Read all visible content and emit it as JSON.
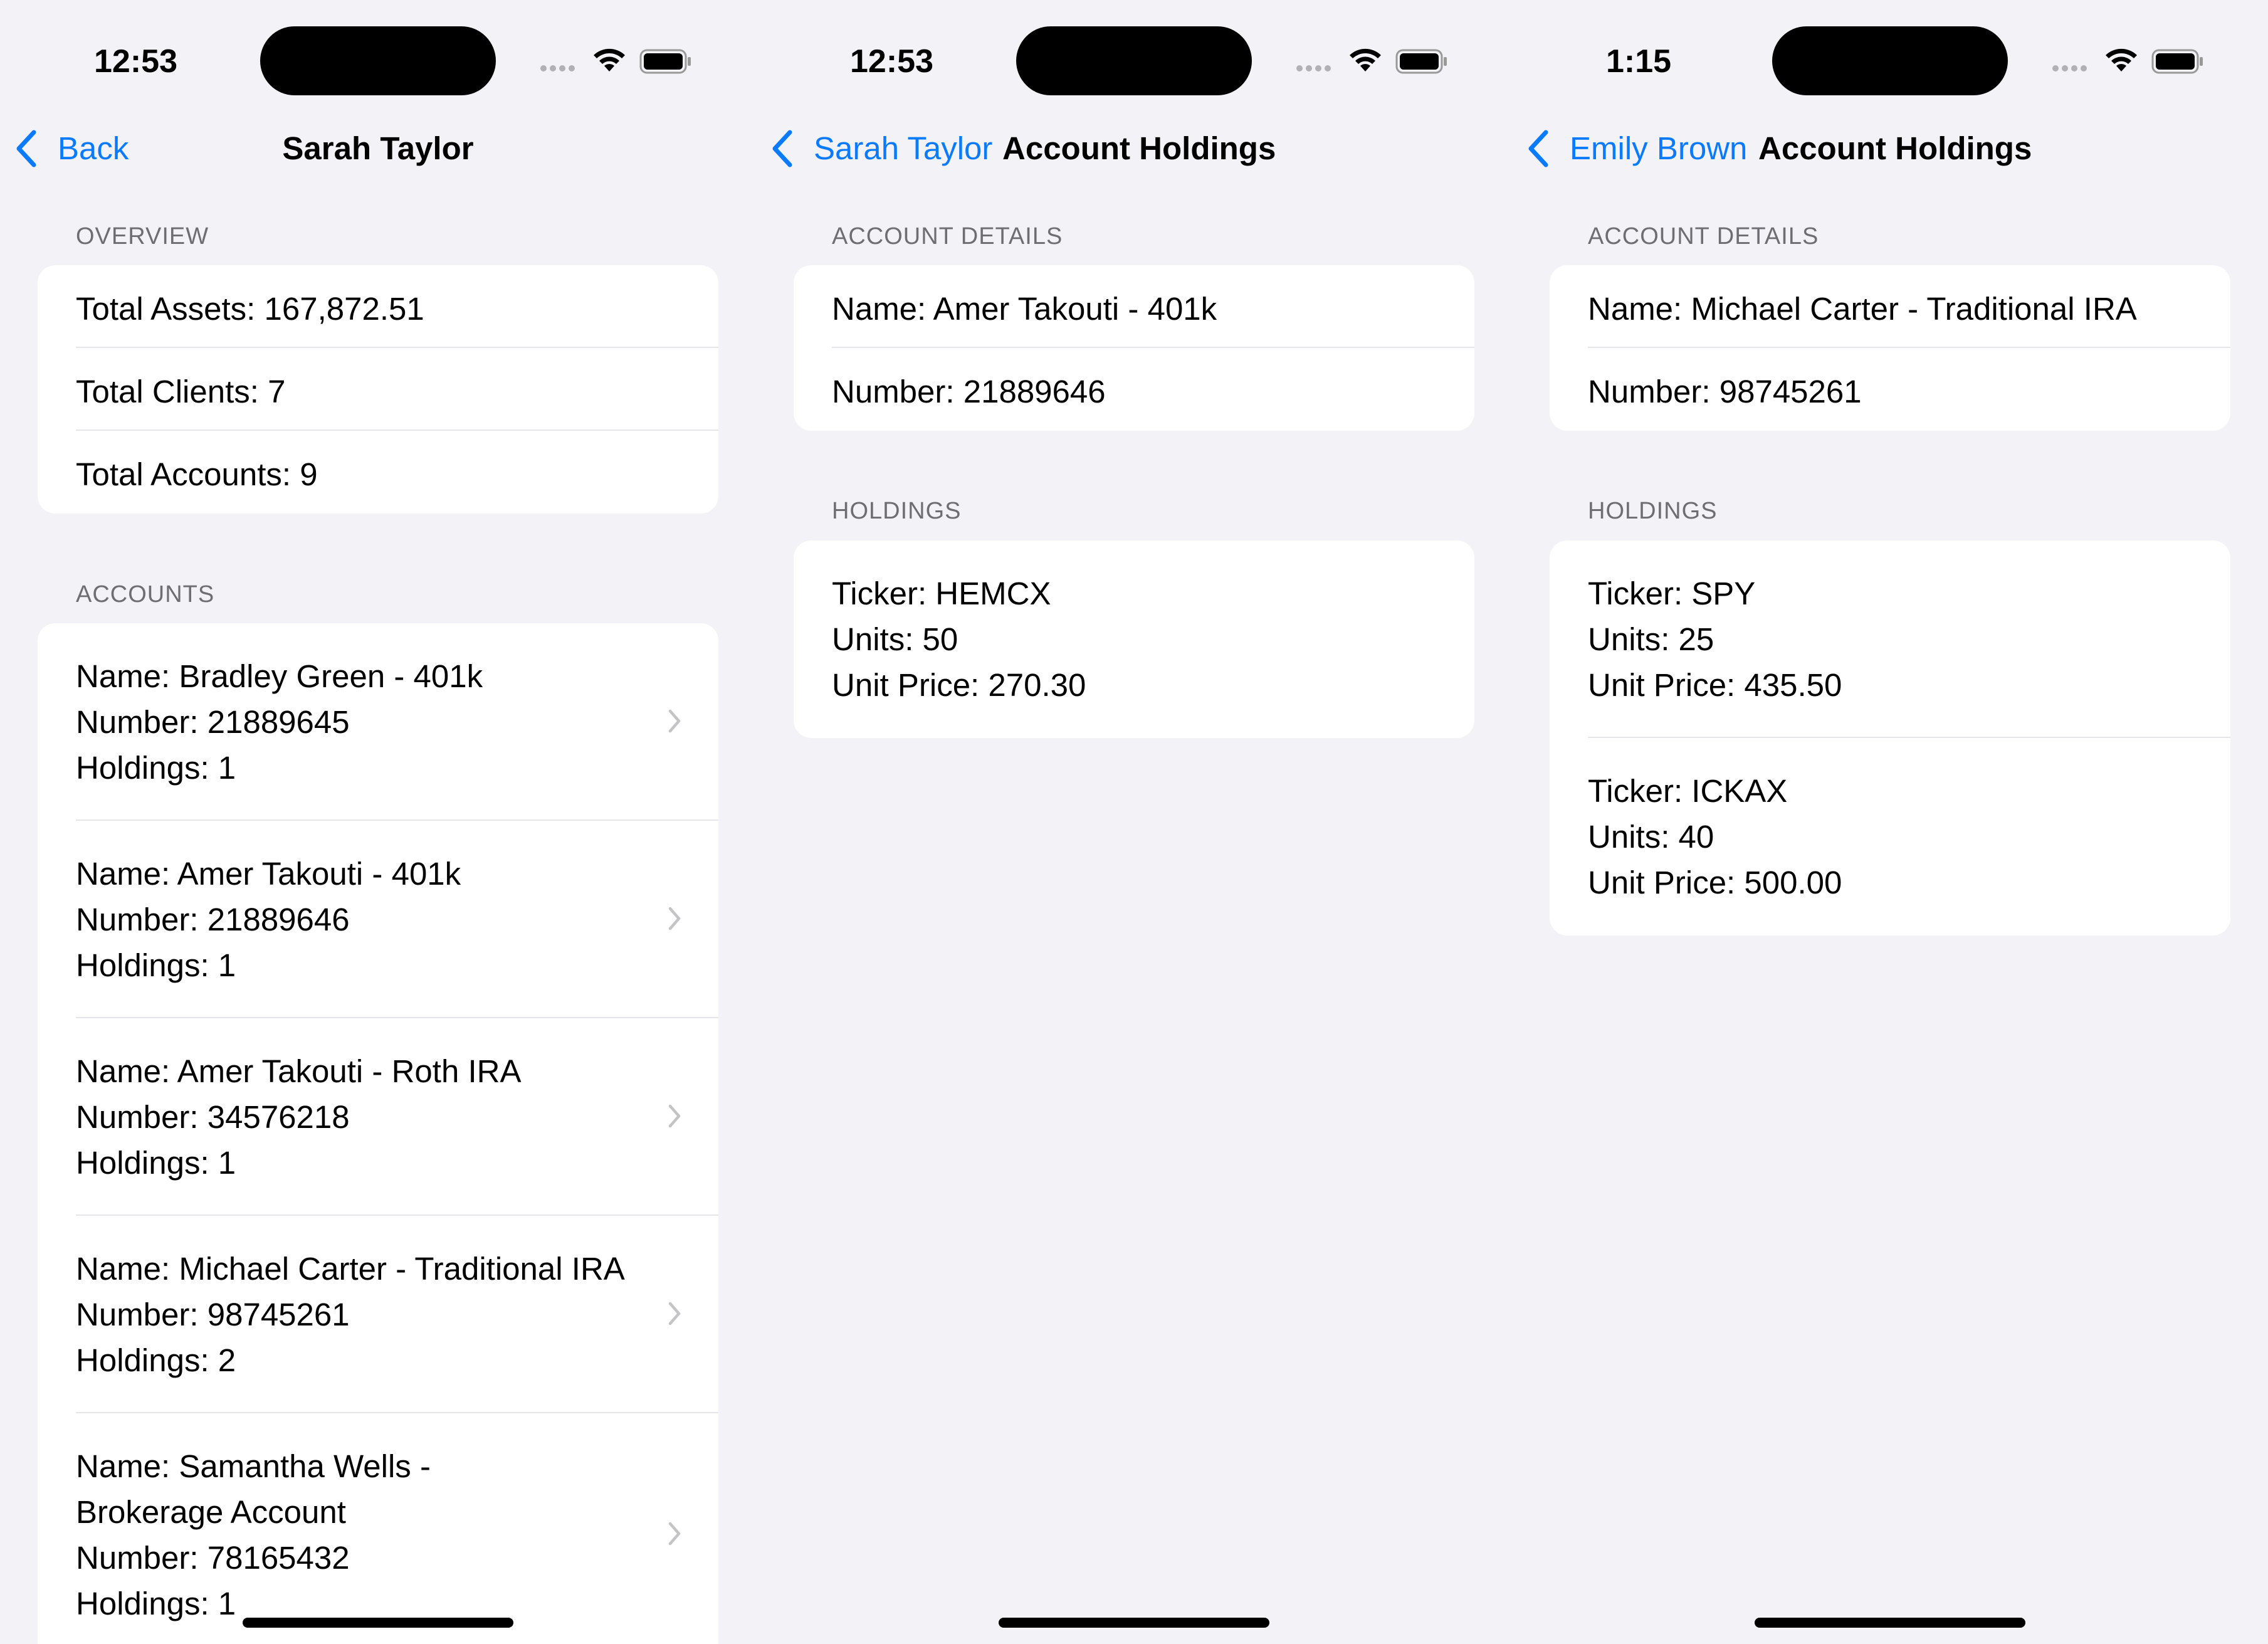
{
  "colors": {
    "background": "#f2f2f7",
    "accent": "#0a7aff",
    "card": "#ffffff",
    "secondary_text": "#6d6d72"
  },
  "screens": [
    {
      "status": {
        "time": "12:53"
      },
      "nav": {
        "back_label": "Back",
        "title": "Sarah Taylor"
      },
      "overview": {
        "header": "OVERVIEW",
        "rows": [
          "Total Assets: 167,872.51",
          "Total Clients: 7",
          "Total Accounts: 9"
        ]
      },
      "accounts": {
        "header": "ACCOUNTS",
        "items": [
          {
            "name": "Name: Bradley Green - 401k",
            "number": "Number: 21889645",
            "holdings": "Holdings: 1"
          },
          {
            "name": "Name: Amer Takouti - 401k",
            "number": "Number: 21889646",
            "holdings": "Holdings: 1"
          },
          {
            "name": "Name: Amer Takouti - Roth IRA",
            "number": "Number: 34576218",
            "holdings": "Holdings: 1"
          },
          {
            "name": "Name: Michael Carter - Traditional IRA",
            "number": "Number: 98745261",
            "holdings": "Holdings: 2"
          },
          {
            "name": "Name: Samantha Wells -",
            "name_cont": "Brokerage Account",
            "number": "Number: 78165432",
            "holdings": "Holdings: 1"
          }
        ]
      }
    },
    {
      "status": {
        "time": "12:53"
      },
      "nav": {
        "back_label": "Sarah Taylor",
        "title": "Account Holdings"
      },
      "details": {
        "header": "ACCOUNT DETAILS",
        "name": "Name: Amer Takouti - 401k",
        "number": "Number: 21889646"
      },
      "holdings": {
        "header": "HOLDINGS",
        "items": [
          {
            "ticker": "Ticker: HEMCX",
            "units": "Units: 50",
            "price": "Unit Price: 270.30"
          }
        ]
      }
    },
    {
      "status": {
        "time": "1:15"
      },
      "nav": {
        "back_label": "Emily Brown",
        "title": "Account Holdings"
      },
      "details": {
        "header": "ACCOUNT DETAILS",
        "name": "Name: Michael Carter - Traditional IRA",
        "number": "Number: 98745261"
      },
      "holdings": {
        "header": "HOLDINGS",
        "items": [
          {
            "ticker": "Ticker: SPY",
            "units": "Units: 25",
            "price": "Unit Price: 435.50"
          },
          {
            "ticker": "Ticker: ICKAX",
            "units": "Units: 40",
            "price": "Unit Price: 500.00"
          }
        ]
      }
    }
  ]
}
